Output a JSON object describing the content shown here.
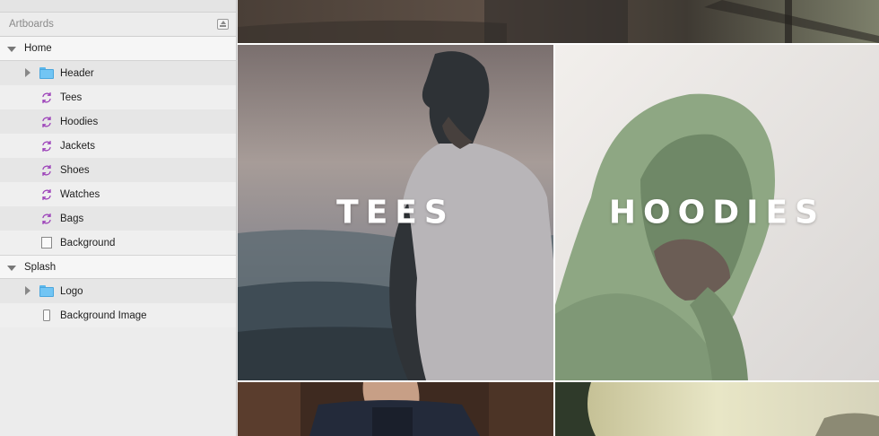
{
  "sidebar": {
    "header": {
      "label": "Artboards"
    },
    "groups": [
      {
        "label": "Home",
        "items": [
          {
            "label": "Header",
            "icon": "folder-icon"
          },
          {
            "label": "Tees",
            "icon": "symbol-icon"
          },
          {
            "label": "Hoodies",
            "icon": "symbol-icon"
          },
          {
            "label": "Jackets",
            "icon": "symbol-icon"
          },
          {
            "label": "Shoes",
            "icon": "symbol-icon"
          },
          {
            "label": "Watches",
            "icon": "symbol-icon"
          },
          {
            "label": "Bags",
            "icon": "symbol-icon"
          },
          {
            "label": "Background",
            "icon": "rectangle-icon"
          }
        ]
      },
      {
        "label": "Splash",
        "items": [
          {
            "label": "Logo",
            "icon": "folder-icon"
          },
          {
            "label": "Background Image",
            "icon": "phone-icon"
          }
        ]
      }
    ]
  },
  "canvas": {
    "tiles": [
      {
        "title": "TEES",
        "image": "man-in-tshirt-mountains"
      },
      {
        "title": "HOODIES",
        "image": "man-in-green-hoodie"
      }
    ]
  },
  "colors": {
    "symbol_icon": "#9b3fb8",
    "folder_icon": "#72c5f4",
    "sidebar_bg": "#ececec"
  }
}
